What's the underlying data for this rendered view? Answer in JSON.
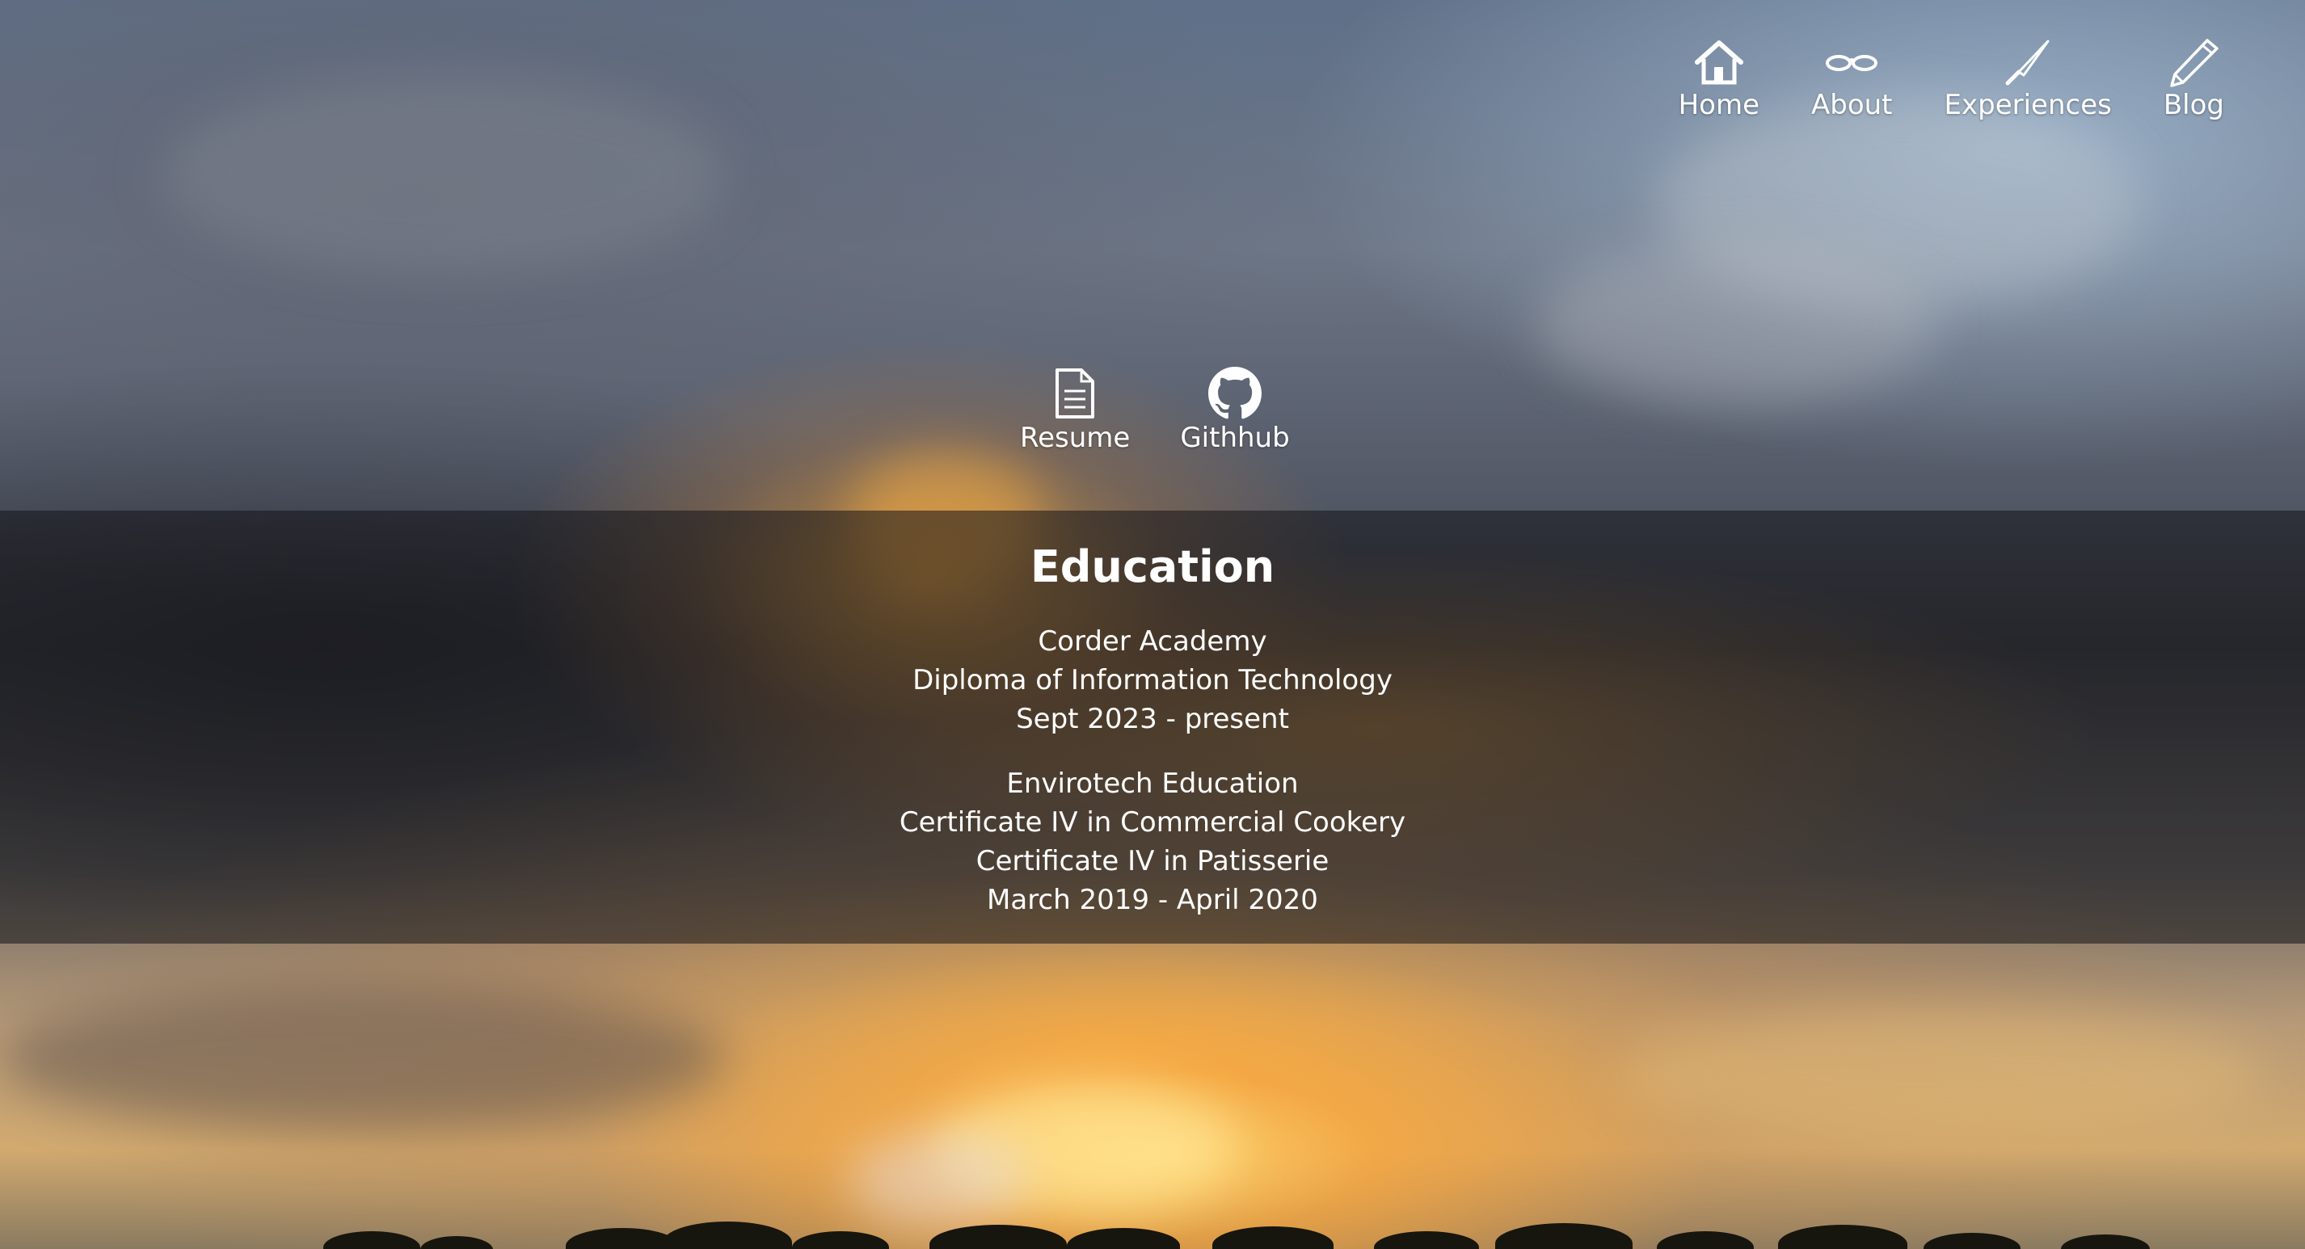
{
  "nav": {
    "items": [
      {
        "label": "Home",
        "icon": "home-icon"
      },
      {
        "label": "About",
        "icon": "glasses-icon"
      },
      {
        "label": "Experiences",
        "icon": "knife-icon"
      },
      {
        "label": "Blog",
        "icon": "pencil-icon"
      }
    ]
  },
  "links": {
    "items": [
      {
        "label": "Resume",
        "icon": "document-icon"
      },
      {
        "label": "Githhub",
        "icon": "github-icon"
      }
    ]
  },
  "education": {
    "title": "Education",
    "entries": [
      {
        "lines": [
          "Corder Academy",
          "Diploma of Information Technology",
          "Sept 2023 - present"
        ]
      },
      {
        "lines": [
          "Envirotech Education",
          "Certificate IV in Commercial Cookery",
          "Certificate IV in Patisserie",
          "March 2019 - April 2020"
        ]
      }
    ]
  },
  "colors": {
    "text": "#ffffff",
    "panel_overlay": "rgba(20,20,24,0.55)"
  }
}
